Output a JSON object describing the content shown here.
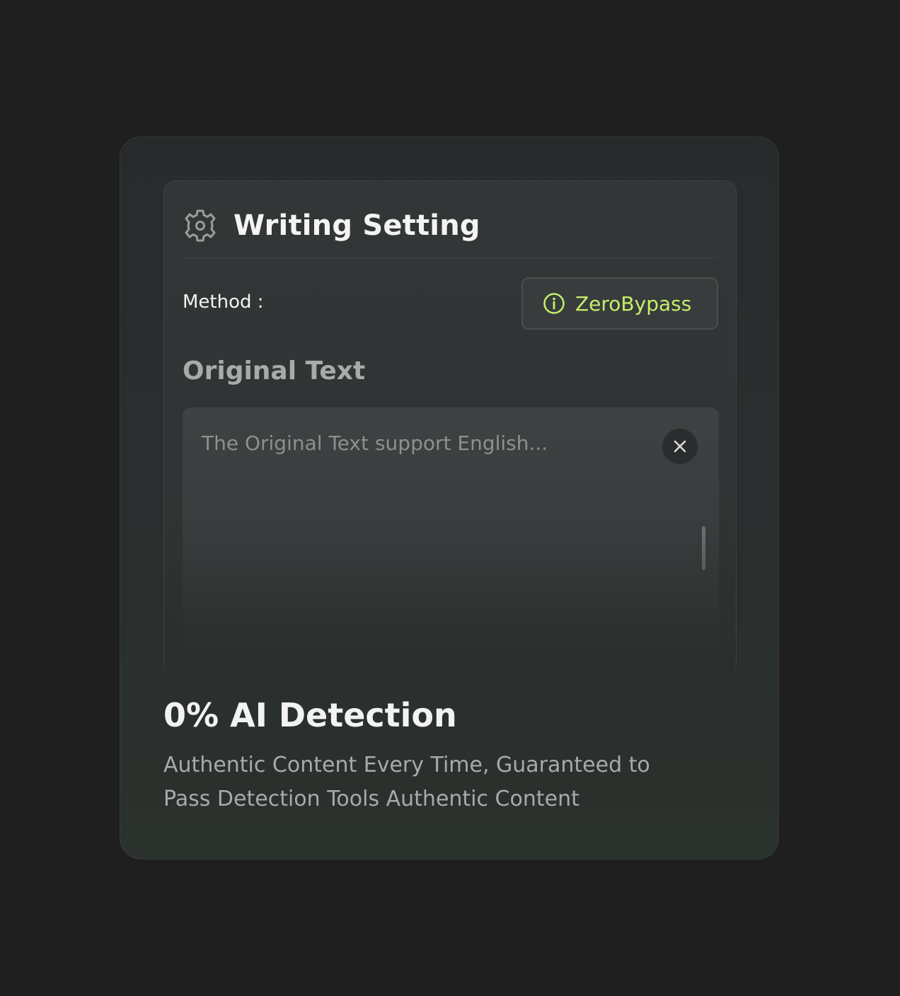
{
  "panel": {
    "title": "Writing Setting",
    "icon": "gear-icon",
    "method_label": "Method :",
    "method_value": "ZeroBypass",
    "method_icon": "info-icon",
    "method_accent": "#c4f06a",
    "section_heading": "Original Text",
    "textarea_placeholder": "The Original Text support English...",
    "clear_icon": "close-icon"
  },
  "feature": {
    "headline": "0% AI Detection",
    "description": "Authentic Content Every Time, Guaranteed to Pass Detection Tools Authentic Content"
  }
}
